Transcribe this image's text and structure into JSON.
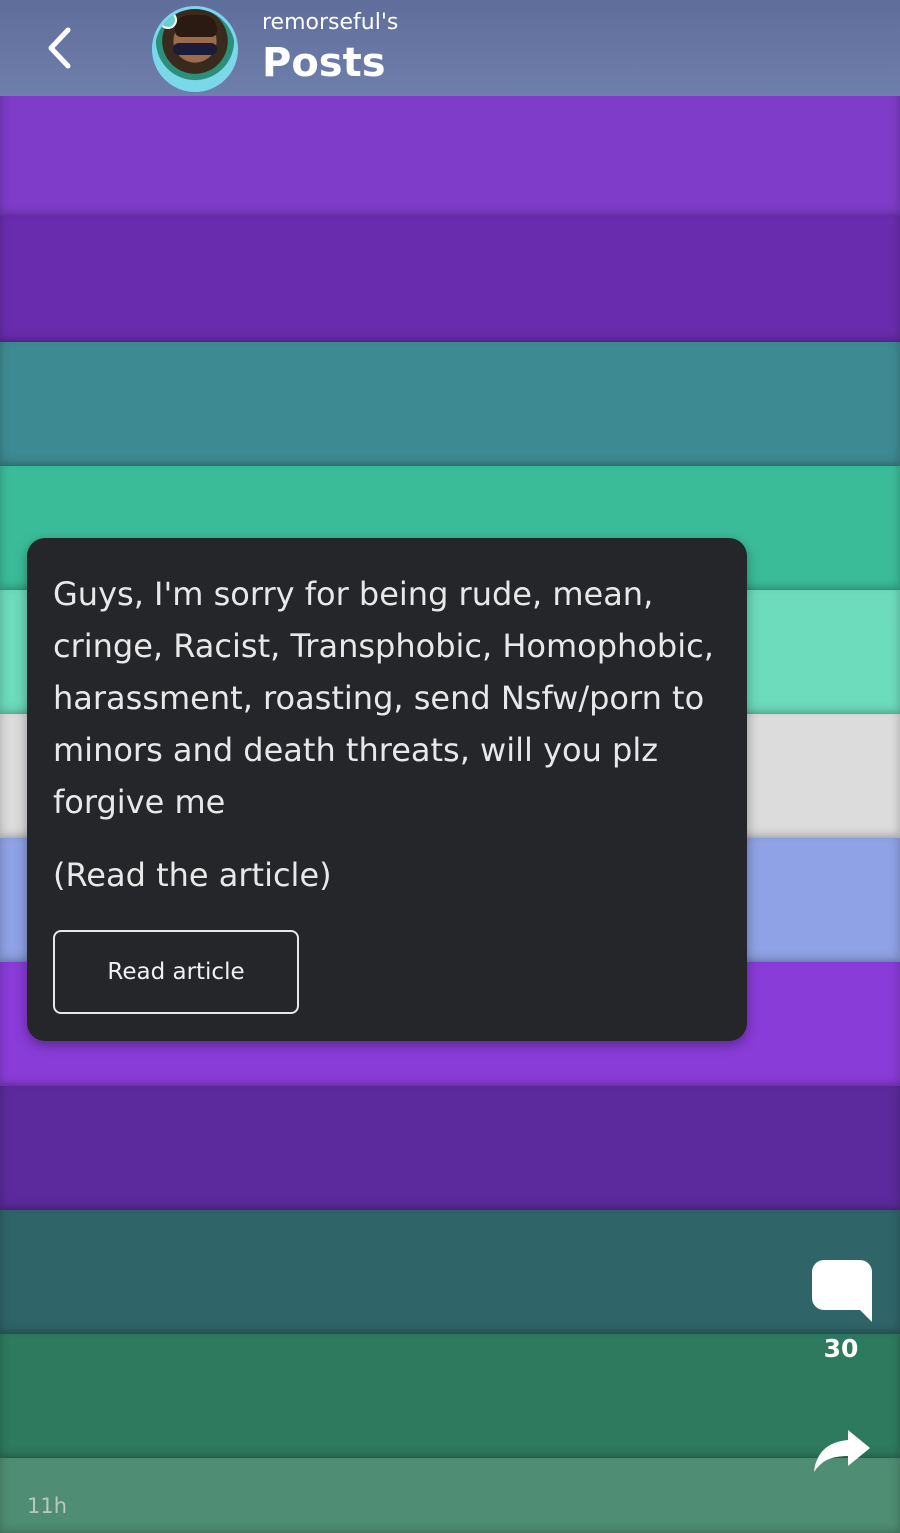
{
  "header": {
    "owner": "remorseful's",
    "title": "Posts"
  },
  "post": {
    "text": "Guys, I'm sorry for being rude, mean, cringe, Racist, Transphobic, Homophobic, harassment, roasting, send Nsfw/porn to minors and death threats, will you plz forgive me",
    "note": "(Read the article)",
    "button_label": "Read article",
    "comment_count": "30",
    "timestamp": "11h"
  },
  "icons": {
    "back": "back-icon",
    "comment": "comment-icon",
    "share": "share-icon"
  },
  "colors": {
    "card": "#25262a",
    "text": "#e8e8e8"
  }
}
